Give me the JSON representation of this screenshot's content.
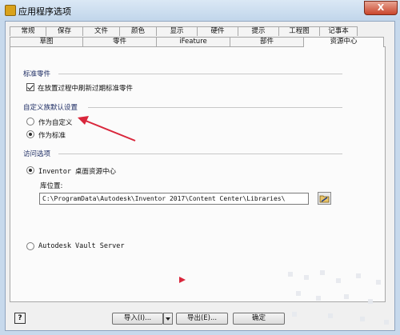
{
  "window": {
    "title": "应用程序选项",
    "close_label": "X"
  },
  "tabs_row1": [
    "常规",
    "保存",
    "文件",
    "颜色",
    "显示",
    "硬件",
    "提示",
    "工程图",
    "记事本"
  ],
  "tabs_row2": [
    "草图",
    "零件",
    "iFeature",
    "部件",
    "资源中心"
  ],
  "active_tab": "资源中心",
  "groups": {
    "standard_parts": {
      "title": "标准零件",
      "refresh_checkbox": {
        "label": "在放置过程中刷新过期标准零件",
        "checked": true
      }
    },
    "custom_family": {
      "title": "自定义族默认设置",
      "options": [
        {
          "label": "作为自定义",
          "selected": false
        },
        {
          "label": "作为标准",
          "selected": true
        }
      ]
    },
    "access": {
      "title": "访问选项",
      "desktop_option": {
        "label": "Inventor 桌面资源中心",
        "selected": true
      },
      "library_location_label": "库位置:",
      "library_path": "C:\\ProgramData\\Autodesk\\Inventor 2017\\Content Center\\Libraries\\",
      "vault_option": {
        "label": "Autodesk Vault Server",
        "selected": false
      }
    }
  },
  "buttons": {
    "help": "?",
    "import": "导入(I)...",
    "export": "导出(E)...",
    "ok": "确定"
  },
  "icons": [
    "app-icon",
    "folder-browse-icon",
    "red-arrow-annotation-icon",
    "red-triangle-marker-icon"
  ],
  "colors": {
    "annotation": "#d9263b",
    "title_bar": "#c7d9ec"
  }
}
